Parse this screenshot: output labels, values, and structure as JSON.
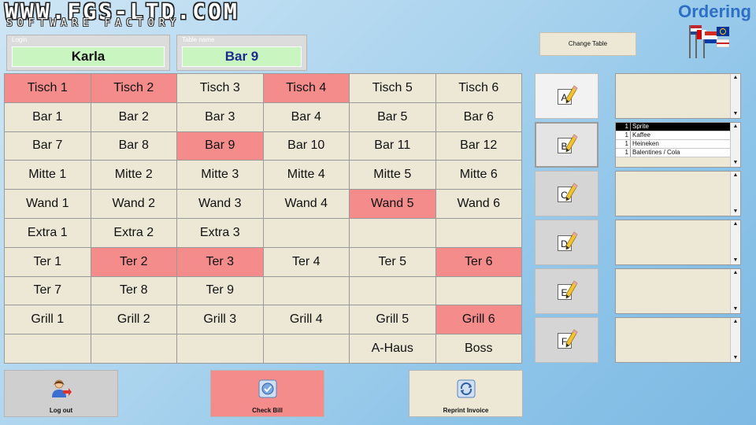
{
  "header": {
    "logo_text": "WWW.FGS-LTD.COM",
    "logo_subtext": "SOFTWARE FACTORY",
    "title": "Ordering"
  },
  "login": {
    "label": "Login",
    "value": "Karla"
  },
  "table_name": {
    "label": "Table name",
    "value": "Bar 9"
  },
  "change_table_label": "Change Table",
  "colors": {
    "active_table": "#f48c8c",
    "table": "#ede8d6",
    "title": "#2e6fc4"
  },
  "tables": [
    [
      {
        "name": "Tisch 1",
        "active": true
      },
      {
        "name": "Tisch 2",
        "active": true
      },
      {
        "name": "Tisch 3",
        "active": false
      },
      {
        "name": "Tisch 4",
        "active": true
      },
      {
        "name": "Tisch 5",
        "active": false
      },
      {
        "name": "Tisch 6",
        "active": false
      }
    ],
    [
      {
        "name": "Bar 1",
        "active": false
      },
      {
        "name": "Bar 2",
        "active": false
      },
      {
        "name": "Bar 3",
        "active": false
      },
      {
        "name": "Bar 4",
        "active": false
      },
      {
        "name": "Bar 5",
        "active": false
      },
      {
        "name": "Bar 6",
        "active": false
      }
    ],
    [
      {
        "name": "Bar 7",
        "active": false
      },
      {
        "name": "Bar 8",
        "active": false
      },
      {
        "name": "Bar 9",
        "active": true
      },
      {
        "name": "Bar 10",
        "active": false
      },
      {
        "name": "Bar 11",
        "active": false
      },
      {
        "name": "Bar 12",
        "active": false
      }
    ],
    [
      {
        "name": "Mitte 1",
        "active": false
      },
      {
        "name": "Mitte 2",
        "active": false
      },
      {
        "name": "Mitte 3",
        "active": false
      },
      {
        "name": "Mitte 4",
        "active": false
      },
      {
        "name": "Mitte 5",
        "active": false
      },
      {
        "name": "Mitte 6",
        "active": false
      }
    ],
    [
      {
        "name": "Wand 1",
        "active": false
      },
      {
        "name": "Wand 2",
        "active": false
      },
      {
        "name": "Wand 3",
        "active": false
      },
      {
        "name": "Wand 4",
        "active": false
      },
      {
        "name": "Wand 5",
        "active": true
      },
      {
        "name": "Wand 6",
        "active": false
      }
    ],
    [
      {
        "name": "Extra 1",
        "active": false
      },
      {
        "name": "Extra 2",
        "active": false
      },
      {
        "name": "Extra 3",
        "active": false
      },
      {
        "name": "",
        "active": false
      },
      {
        "name": "",
        "active": false
      },
      {
        "name": "",
        "active": false
      }
    ],
    [
      {
        "name": "Ter 1",
        "active": false
      },
      {
        "name": "Ter 2",
        "active": true
      },
      {
        "name": "Ter 3",
        "active": true
      },
      {
        "name": "Ter 4",
        "active": false
      },
      {
        "name": "Ter 5",
        "active": false
      },
      {
        "name": "Ter 6",
        "active": true
      }
    ],
    [
      {
        "name": "Ter 7",
        "active": false
      },
      {
        "name": "Ter 8",
        "active": false
      },
      {
        "name": "Ter 9",
        "active": false
      },
      {
        "name": "",
        "active": false
      },
      {
        "name": "",
        "active": false
      },
      {
        "name": "",
        "active": false
      }
    ],
    [
      {
        "name": "Grill 1",
        "active": false
      },
      {
        "name": "Grill 2",
        "active": false
      },
      {
        "name": "Grill 3",
        "active": false
      },
      {
        "name": "Grill 4",
        "active": false
      },
      {
        "name": "Grill 5",
        "active": false
      },
      {
        "name": "Grill 6",
        "active": true
      }
    ],
    [
      {
        "name": "",
        "active": false
      },
      {
        "name": "",
        "active": false
      },
      {
        "name": "",
        "active": false
      },
      {
        "name": "",
        "active": false
      },
      {
        "name": "A-Haus",
        "active": false
      },
      {
        "name": "Boss",
        "active": false
      }
    ]
  ],
  "categories": [
    {
      "letter": "A",
      "icon": "pencil-note-icon"
    },
    {
      "letter": "B",
      "icon": "pencil-note-icon"
    },
    {
      "letter": "C",
      "icon": "pencil-note-icon"
    },
    {
      "letter": "D",
      "icon": "pencil-note-icon"
    },
    {
      "letter": "E",
      "icon": "pencil-note-icon"
    },
    {
      "letter": "F",
      "icon": "pencil-note-icon"
    }
  ],
  "order_lists": [
    [],
    [
      {
        "qty": "1",
        "item": "Sprite",
        "selected": true
      },
      {
        "qty": "1",
        "item": "Kaffee",
        "selected": false
      },
      {
        "qty": "1",
        "item": "Heineken",
        "selected": false
      },
      {
        "qty": "1",
        "item": "Balentines / Cola",
        "selected": false
      }
    ],
    [],
    [],
    [],
    []
  ],
  "buttons": {
    "logout": "Log out",
    "check_bill": "Check Bill",
    "reprint_invoice": "Reprint Invoice"
  }
}
